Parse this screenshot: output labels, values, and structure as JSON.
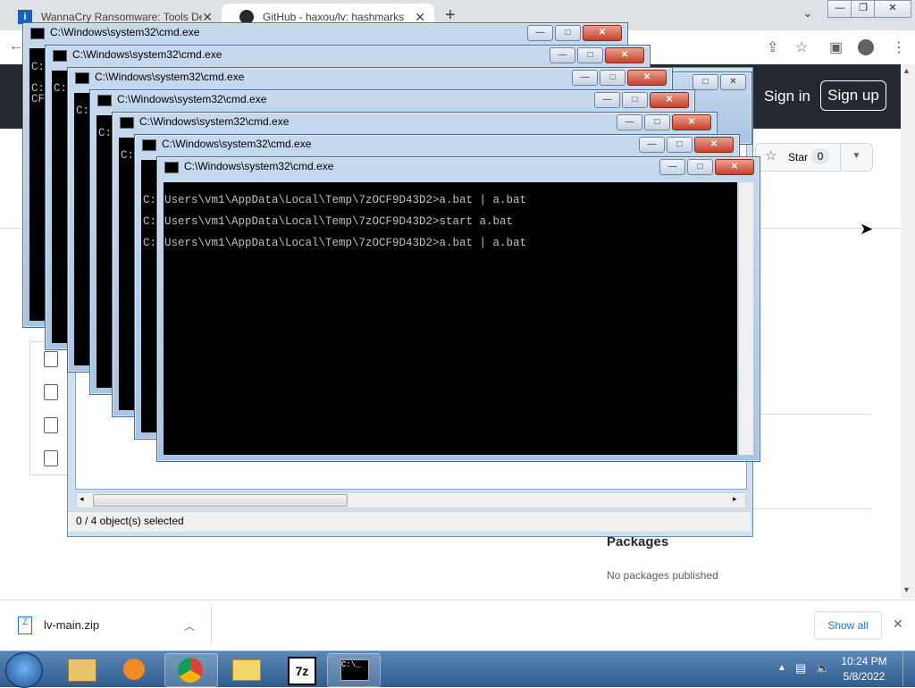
{
  "browser": {
    "tabs": [
      {
        "label": "WannaCry Ransomware: Tools De",
        "icon": "page-icon"
      },
      {
        "label": "GitHub - haxou/lv: hashmarks",
        "icon": "github-icon"
      }
    ],
    "new_tab": "+"
  },
  "github": {
    "sign_in": "Sign in",
    "sign_up": "Sign up",
    "star_label": "Star",
    "star_count": "0",
    "packages_title": "Packages",
    "packages_empty": "No packages published"
  },
  "download": {
    "filename": "lv-main.zip",
    "show_all": "Show all"
  },
  "explorer": {
    "status": "0 / 4 object(s) selected"
  },
  "cmd": {
    "title": "C:\\Windows\\system32\\cmd.exe",
    "prompt_fragment": "C:",
    "prompt_fragment_alt": "CF",
    "lines": [
      "Users\\vm1\\AppData\\Local\\Temp\\7zOCF9D43D2>a.bat | a.bat",
      "Users\\vm1\\AppData\\Local\\Temp\\7zOCF9D43D2>start a.bat",
      "Users\\vm1\\AppData\\Local\\Temp\\7zOCF9D43D2>a.bat | a.bat"
    ]
  },
  "taskbar": {
    "time": "10:24 PM",
    "date": "5/8/2022",
    "apps": [
      "explorer-icon",
      "media-player-icon",
      "chrome-icon",
      "folder-icon",
      "7zip-icon",
      "cmd-icon"
    ]
  }
}
